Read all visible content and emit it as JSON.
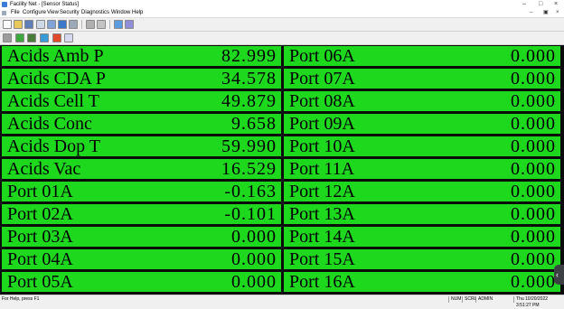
{
  "window": {
    "title": "Facility Net - [Sensor Status]"
  },
  "menu": [
    "File",
    "Configure",
    "View",
    "Security",
    "Diagnostics",
    "Window",
    "Help"
  ],
  "toolbar1_icons": [
    "new-icon",
    "open-icon",
    "save-icon",
    "cut-icon",
    "copy-icon",
    "paste-icon",
    "print-icon",
    "graph-icon",
    "network-icon",
    "stack-icon",
    "about-icon"
  ],
  "toolbar2_icons": [
    "printer-icon",
    "table-icon",
    "download-icon",
    "export-icon",
    "refresh-icon",
    "help-icon"
  ],
  "sensors": [
    {
      "name": "Acids Amb P",
      "value": "82.999"
    },
    {
      "name": "Acids CDA P",
      "value": "34.578"
    },
    {
      "name": "Acids Cell T",
      "value": "49.879"
    },
    {
      "name": "Acids Conc",
      "value": "9.658"
    },
    {
      "name": "Acids Dop T",
      "value": "59.990"
    },
    {
      "name": "Acids Vac",
      "value": "16.529"
    },
    {
      "name": "Port 01A",
      "value": "-0.163"
    },
    {
      "name": "Port 02A",
      "value": "-0.101"
    },
    {
      "name": "Port 03A",
      "value": "0.000"
    },
    {
      "name": "Port 04A",
      "value": "0.000"
    },
    {
      "name": "Port 05A",
      "value": "0.000"
    },
    {
      "name": "Port 06A",
      "value": "0.000"
    },
    {
      "name": "Port 07A",
      "value": "0.000"
    },
    {
      "name": "Port 08A",
      "value": "0.000"
    },
    {
      "name": "Port 09A",
      "value": "0.000"
    },
    {
      "name": "Port 10A",
      "value": "0.000"
    },
    {
      "name": "Port 11A",
      "value": "0.000"
    },
    {
      "name": "Port 12A",
      "value": "0.000"
    },
    {
      "name": "Port 13A",
      "value": "0.000"
    },
    {
      "name": "Port 14A",
      "value": "0.000"
    },
    {
      "name": "Port 15A",
      "value": "0.000"
    },
    {
      "name": "Port 16A",
      "value": "0.000"
    }
  ],
  "colors": {
    "cell_ok": "#1ed81e",
    "grid_bg": "#0b0b0b"
  },
  "statusbar": {
    "help_text": "For Help, press F1",
    "num": "NUM",
    "scrl": "SCRL",
    "user": "ADMIN",
    "datetime": "Thu 10/20/2022 3:51:27 PM"
  }
}
